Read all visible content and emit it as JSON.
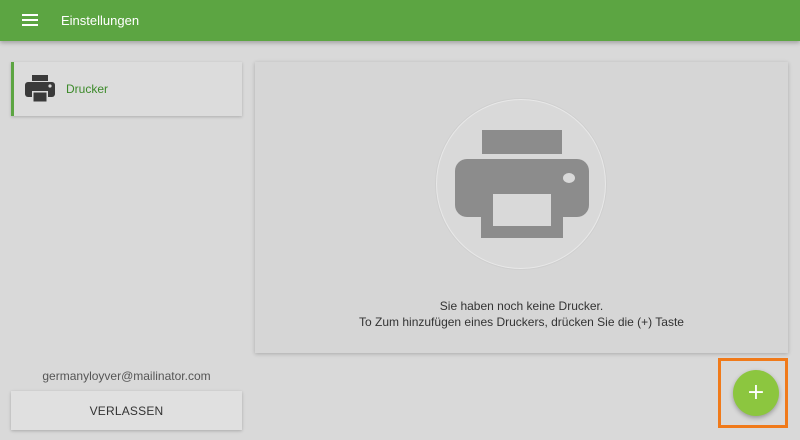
{
  "header": {
    "title": "Einstellungen",
    "menu_icon": "menu-icon"
  },
  "sidebar": {
    "items": [
      {
        "label": "Drucker",
        "icon": "printer-icon",
        "selected": true
      }
    ],
    "user_email": "germanyloyver@mailinator.com",
    "logout_label": "VERLASSEN"
  },
  "main": {
    "empty_state": {
      "icon": "printer-icon",
      "line1": "Sie haben noch keine Drucker.",
      "line2": "To Zum hinzufügen eines Druckers, drücken Sie die (+) Taste"
    }
  },
  "fab": {
    "label": "+",
    "icon": "plus-icon",
    "highlighted": true
  },
  "colors": {
    "accent": "#5ca542",
    "fab": "#8cc63f",
    "highlight": "#f07a1a",
    "background": "#d9d9d9"
  }
}
